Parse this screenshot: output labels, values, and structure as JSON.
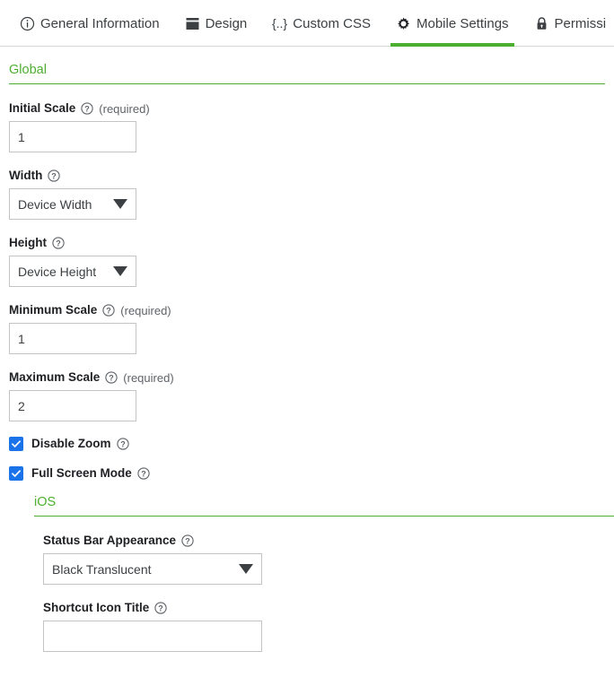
{
  "tabs": [
    {
      "label": "General Information",
      "icon": "info-circle-icon",
      "active": false
    },
    {
      "label": "Design",
      "icon": "layout-icon",
      "active": false
    },
    {
      "label": "Custom CSS",
      "icon": "code-braces-icon",
      "active": false
    },
    {
      "label": "Mobile Settings",
      "icon": "gear-icon",
      "active": true
    },
    {
      "label": "Permissi",
      "icon": "lock-icon",
      "active": false
    }
  ],
  "colors": {
    "accent_green": "#4caf30",
    "checkbox_blue": "#1a73e8",
    "text": "#3c4043",
    "border": "#c4c4c4"
  },
  "global_section": {
    "title": "Global",
    "initial_scale": {
      "label": "Initial Scale",
      "required_text": "(required)",
      "value": "1"
    },
    "width": {
      "label": "Width",
      "value": "Device Width"
    },
    "height": {
      "label": "Height",
      "value": "Device Height"
    },
    "minimum_scale": {
      "label": "Minimum Scale",
      "required_text": "(required)",
      "value": "1"
    },
    "maximum_scale": {
      "label": "Maximum Scale",
      "required_text": "(required)",
      "value": "2"
    },
    "disable_zoom": {
      "label": "Disable Zoom",
      "checked": true
    },
    "full_screen_mode": {
      "label": "Full Screen Mode",
      "checked": true
    }
  },
  "ios_section": {
    "title": "iOS",
    "status_bar_appearance": {
      "label": "Status Bar Appearance",
      "value": "Black Translucent"
    },
    "shortcut_icon_title": {
      "label": "Shortcut Icon Title",
      "value": ""
    }
  }
}
